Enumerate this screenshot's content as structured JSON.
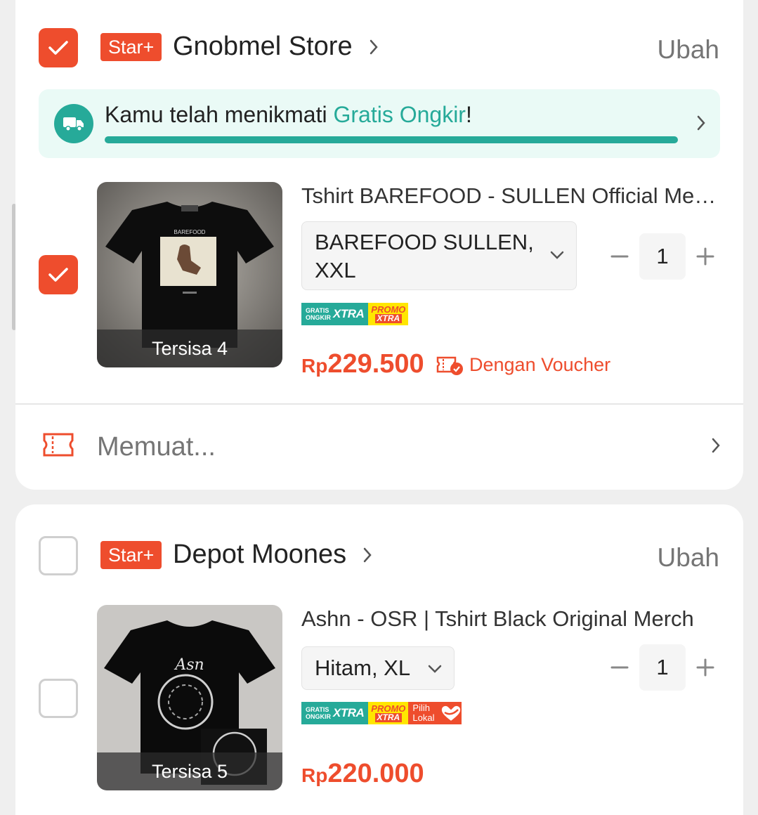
{
  "stores": [
    {
      "checked": true,
      "badge": "Star+",
      "name": "Gnobmel Store",
      "edit_label": "Ubah",
      "shipping": {
        "prefix": "Kamu telah menikmati ",
        "highlight": "Gratis Ongkir",
        "suffix": "!",
        "progress": 1.0
      },
      "product": {
        "checked": true,
        "title": "Tshirt BAREFOOD - SULLEN Official Merch",
        "variant_line1": "BAREFOOD SULLEN,",
        "variant_line2": "XXL",
        "quantity": "1",
        "stock": "Tersisa 4",
        "price_currency": "Rp",
        "price_amount": "229.500",
        "voucher_note": "Dengan Voucher",
        "badges": [
          "GRATIS ONGKIR XTRA",
          "PROMO XTRA"
        ]
      },
      "voucher_row": {
        "text": "Memuat..."
      }
    },
    {
      "checked": false,
      "badge": "Star+",
      "name": "Depot Moones",
      "edit_label": "Ubah",
      "product": {
        "checked": false,
        "title": "Ashn - OSR | Tshirt Black Original Merch",
        "variant": "Hitam, XL",
        "quantity": "1",
        "stock": "Tersisa 5",
        "price_currency": "Rp",
        "price_amount": "220.000",
        "badges": [
          "GRATIS ONGKIR XTRA",
          "PROMO XTRA",
          "Pilih Lokal"
        ]
      }
    }
  ],
  "badge_text": {
    "gratis_top": "GRATIS",
    "gratis_bottom": "ONGKIR",
    "xtra": "XTRA",
    "promo": "PROMO",
    "promo_xtra": "XTRA",
    "lokal_top": "Pilih",
    "lokal_bottom": "Lokal"
  },
  "colors": {
    "accent": "#ee4d2d",
    "teal": "#26aa99",
    "promo_yellow": "#ffe600"
  },
  "icons": {
    "checkbox": "check-icon",
    "chevron": "chevron-right-icon",
    "dropdown": "chevron-down-icon",
    "shipping": "truck-icon",
    "voucher": "ticket-icon"
  }
}
